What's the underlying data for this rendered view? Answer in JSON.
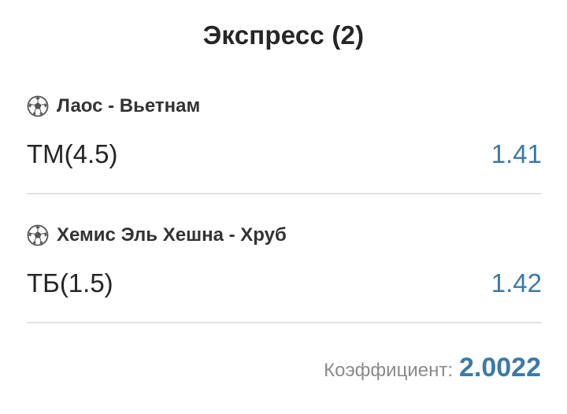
{
  "header": {
    "title": "Экспресс (2)"
  },
  "events": [
    {
      "icon": "soccer-ball-icon",
      "match": "Лаос - Вьетнам",
      "bet": "ТМ(4.5)",
      "odds": "1.41"
    },
    {
      "icon": "soccer-ball-icon",
      "match": "Хемис Эль Хешна - Хруб",
      "bet": "ТБ(1.5)",
      "odds": "1.42"
    }
  ],
  "summary": {
    "label": "Коэффициент:",
    "value": "2.0022"
  },
  "colors": {
    "odds": "#3d7aa5",
    "text": "#262626",
    "muted": "#8a8a8a",
    "divider": "#e2e2e2"
  }
}
